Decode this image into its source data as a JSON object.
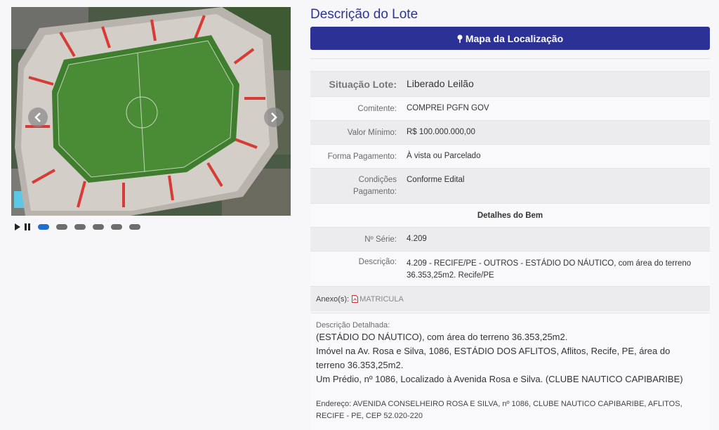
{
  "gallery": {
    "prev_icon": "chevron-left-icon",
    "next_icon": "chevron-right-icon",
    "play_icon": "play-icon",
    "pause_icon": "pause-icon",
    "slide_count": 6,
    "active_slide": 1
  },
  "header": {
    "title": "Descrição do Lote",
    "map_button": "Mapa da Localização",
    "map_icon": "map-pin-icon"
  },
  "lot": {
    "situacao_label": "Situação Lote:",
    "situacao_value": "Liberado Leilão",
    "comitente_label": "Comitente:",
    "comitente_value": "COMPREI PGFN GOV",
    "valor_label": "Valor Mínimo:",
    "valor_value": "R$ 100.000.000,00",
    "forma_label": "Forma Pagamento:",
    "forma_value": "À vista ou Parcelado",
    "cond_label_1": "Condições",
    "cond_label_2": "Pagamento:",
    "cond_value": "Conforme Edital"
  },
  "bem": {
    "heading": "Detalhes do Bem",
    "serie_label": "Nº Série:",
    "serie_value": "4.209",
    "desc_label": "Descrição:",
    "desc_line_1": "4.209 - RECIFE/PE - OUTROS - ESTÁDIO DO NÁUTICO, com área do terreno",
    "desc_line_2": "36.353,25m2. Recife/PE"
  },
  "anexos": {
    "label": "Anexo(s):",
    "icon": "pdf-file-icon",
    "file": "MATRICULA"
  },
  "detalhada": {
    "label": "Descrição Detalhada:",
    "lines": [
      "(ESTÁDIO DO NÁUTICO), com área do terreno 36.353,25m2.",
      "Imóvel na Av. Rosa e Silva, 1086, ESTÁDIO DOS AFLITOS, Aflitos, Recife, PE, área do",
      "terreno 36.353,25m2.",
      "Um Prédio, nº 1086, Localizado à Avenida Rosa e Silva. (CLUBE NAUTICO CAPIBARIBE)"
    ],
    "address_line_1": "Endereço: AVENIDA CONSELHEIRO ROSA E SILVA, nº 1086, CLUBE NAUTICO CAPIBARIBE, AFLITOS,",
    "address_line_2": "RECIFE - PE, CEP 52.020-220"
  },
  "colors": {
    "accent": "#2b3195",
    "title": "#2e3494",
    "active_dot": "#1f6fd1",
    "attachment": "#e0282e"
  }
}
